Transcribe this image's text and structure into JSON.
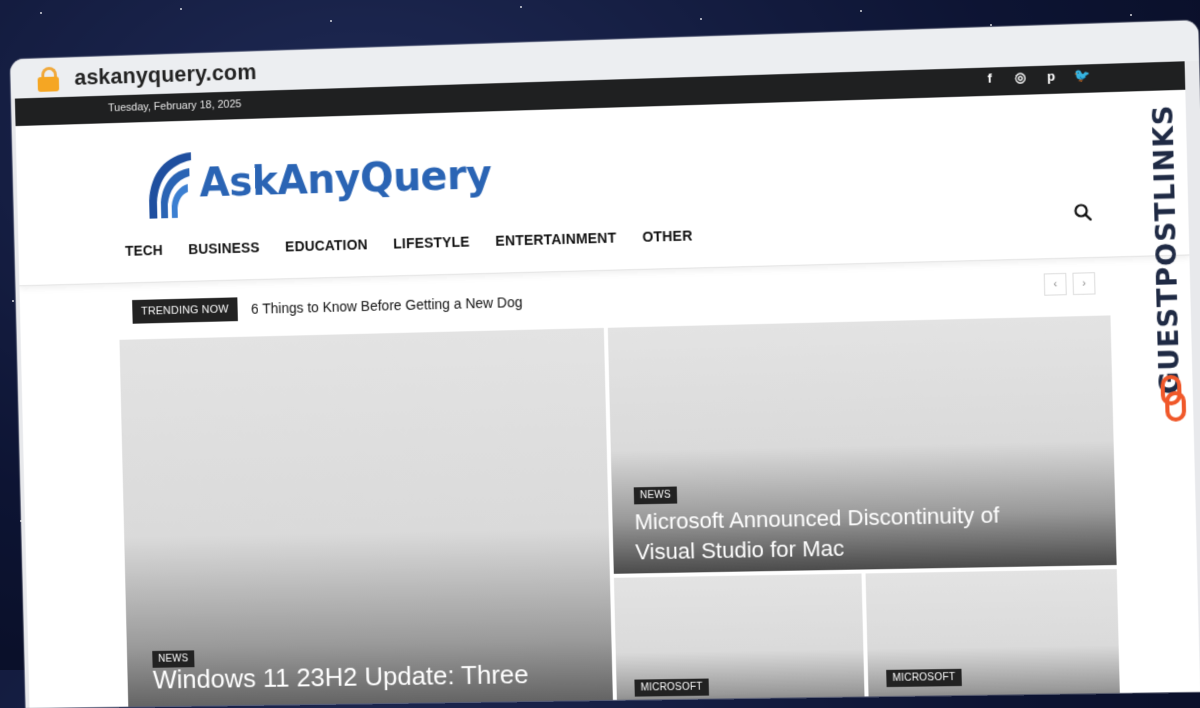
{
  "browser": {
    "url": "askanyquery.com"
  },
  "topbar": {
    "date": "Tuesday, February 18, 2025",
    "social": [
      {
        "icon": "facebook-icon",
        "glyph": "f"
      },
      {
        "icon": "instagram-icon",
        "glyph": "◎"
      },
      {
        "icon": "pinterest-icon",
        "glyph": "p"
      },
      {
        "icon": "twitter-icon",
        "glyph": "🐦"
      }
    ]
  },
  "header": {
    "logo_text": "AskAnyQuery",
    "nav": [
      "TECH",
      "BUSINESS",
      "EDUCATION",
      "LIFESTYLE",
      "ENTERTAINMENT",
      "OTHER"
    ]
  },
  "trending": {
    "label": "TRENDING NOW",
    "headline": "6 Things to Know Before Getting a New Dog"
  },
  "cards": [
    {
      "tag": "NEWS",
      "title": "Windows 11 23H2 Update: Three"
    },
    {
      "tag": "NEWS",
      "title": "Microsoft Announced Discontinuity of Visual Studio for Mac"
    },
    {
      "tag": "MICROSOFT",
      "title": ""
    },
    {
      "tag": "MICROSOFT",
      "title": ""
    }
  ],
  "side_badge": {
    "text": "GUESTPOSTLINKS"
  },
  "colors": {
    "brand_blue": "#2a64b4",
    "topbar": "#1f2021",
    "badge_orange": "#f0582a"
  }
}
